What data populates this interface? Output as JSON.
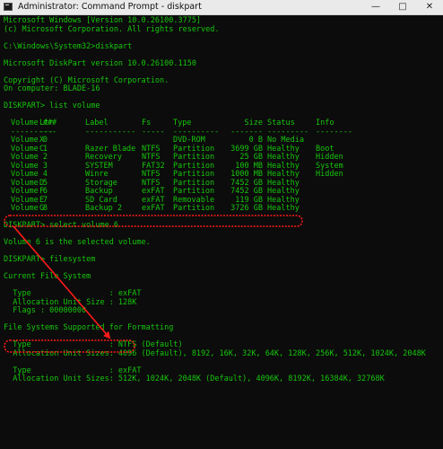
{
  "window": {
    "title": "Administrator: Command Prompt - diskpart",
    "minimize_glyph": "—",
    "maximize_glyph": "□",
    "close_glyph": "✕"
  },
  "console": {
    "header_lines": [
      "Microsoft Windows [Version 10.0.26100.3775]",
      "(c) Microsoft Corporation. All rights reserved.",
      "",
      "C:\\Windows\\System32>diskpart",
      "",
      "Microsoft DiskPart version 10.0.26100.1150",
      "",
      "Copyright (C) Microsoft Corporation.",
      "On computer: BLADE-16",
      "",
      "DISKPART> list volume",
      ""
    ],
    "volume_table": {
      "headers": [
        "Volume ###",
        "Ltr",
        "Label",
        "Fs",
        "Type",
        "Size",
        "Status",
        "Info"
      ],
      "separators": [
        "----------",
        "---",
        "-----------",
        "-----",
        "----------",
        "-------",
        "---------",
        "--------"
      ],
      "rows": [
        [
          "Volume 0",
          "X",
          "",
          "",
          "DVD-ROM",
          "0 B",
          "No Media",
          ""
        ],
        [
          "Volume 1",
          "C",
          "Razer Blade",
          "NTFS",
          "Partition",
          "3699 GB",
          "Healthy",
          "Boot"
        ],
        [
          "Volume 2",
          "",
          "Recovery",
          "NTFS",
          "Partition",
          "25 GB",
          "Healthy",
          "Hidden"
        ],
        [
          "Volume 3",
          "",
          "SYSTEM",
          "FAT32",
          "Partition",
          "100 MB",
          "Healthy",
          "System"
        ],
        [
          "Volume 4",
          "",
          "Winre",
          "NTFS",
          "Partition",
          "1000 MB",
          "Healthy",
          "Hidden"
        ],
        [
          "Volume 5",
          "D",
          "Storage",
          "NTFS",
          "Partition",
          "7452 GB",
          "Healthy",
          ""
        ],
        [
          "Volume 6",
          "F",
          "Backup",
          "exFAT",
          "Partition",
          "7452 GB",
          "Healthy",
          ""
        ],
        [
          "Volume 7",
          "E",
          "SD Card",
          "exFAT",
          "Removable",
          "119 GB",
          "Healthy",
          ""
        ],
        [
          "Volume 8",
          "G",
          "Backup 2",
          "exFAT",
          "Partition",
          "3726 GB",
          "Healthy",
          ""
        ]
      ]
    },
    "footer_lines": [
      "",
      "DISKPART> select volume 6",
      "",
      "Volume 6 is the selected volume.",
      "",
      "DISKPART> filesystem",
      "",
      "Current File System",
      "",
      "  Type                 : exFAT",
      "  Allocation Unit Size : 128K",
      "  Flags : 00000000",
      "",
      "File Systems Supported for Formatting",
      "",
      "  Type                 : NTFS (Default)",
      "  Allocation Unit Sizes: 4096 (Default), 8192, 16K, 32K, 64K, 128K, 256K, 512K, 1024K, 2048K",
      "",
      "  Type                 : exFAT",
      "  Allocation Unit Sizes: 512K, 1024K, 2048K (Default), 4096K, 8192K, 16384K, 32768K"
    ]
  },
  "annotations": {
    "color": "#ff1a1a"
  },
  "colors": {
    "console_text": "#16c60c",
    "console_bg": "#0c0c0c",
    "titlebar_bg": "#eaeaea"
  }
}
